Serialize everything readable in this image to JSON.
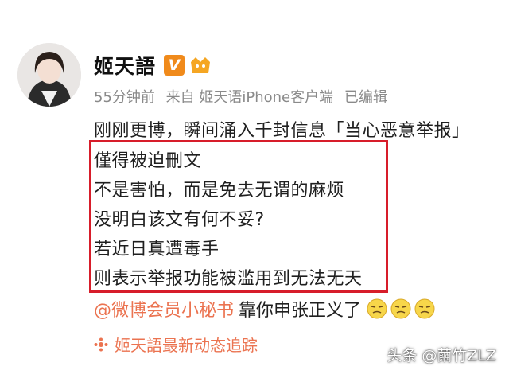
{
  "post": {
    "username": "姬天語",
    "vip_badge": "V",
    "meta": {
      "time": "55分钟前",
      "source": "来自 姬天语iPhone客户端",
      "edited": "已编辑"
    },
    "lines": [
      "刚刚更博，瞬间涌入千封信息「当心恶意举报」",
      "僅得被迫刪文",
      "不是害怕，而是免去无谓的麻烦",
      "没明白该文有何不妥?",
      "若近日真遭毒手",
      "则表示举报功能被滥用到无法无天"
    ],
    "mention": "@微博会员小秘书",
    "mention_tail": "靠你申张正义了",
    "topic": "姬天語最新动态追踪"
  },
  "watermark": "头条 @繭竹ZLZ",
  "colors": {
    "highlight_border": "#d71d2a",
    "link": "#eb7350",
    "meta": "#8a8a8a",
    "vip": "#f08a1b"
  },
  "icons": [
    "avatar",
    "vip-v-icon",
    "level-icon",
    "emoji-icon",
    "topic-icon"
  ]
}
